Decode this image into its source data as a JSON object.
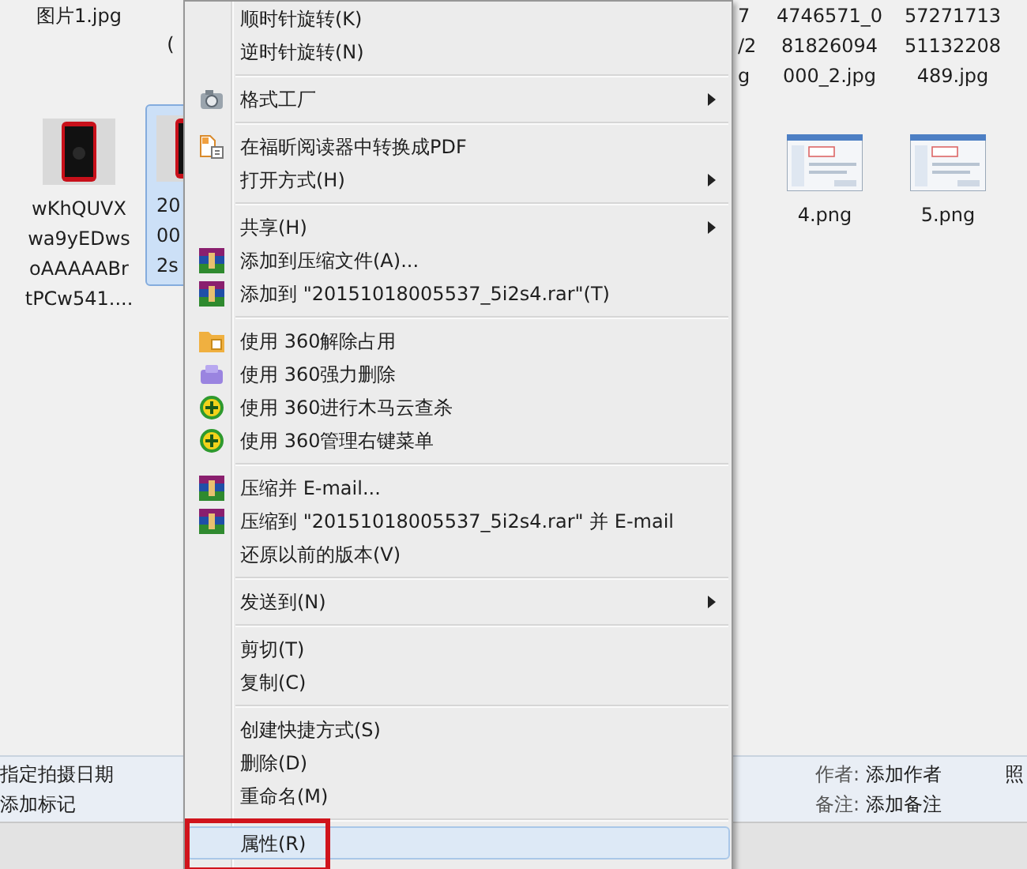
{
  "files": [
    {
      "kind": "label_only",
      "lines": [
        "图片1.jpg"
      ],
      "selected": false
    },
    {
      "kind": "label_only",
      "lines": [
        "("
      ],
      "selected": false
    },
    {
      "kind": "label_only",
      "lines": [
        "7",
        "/2",
        "g"
      ],
      "selected": false
    },
    {
      "kind": "label_only",
      "lines": [
        "4746571_0",
        "81826094",
        "000_2.jpg"
      ],
      "selected": false
    },
    {
      "kind": "label_only",
      "lines": [
        "57271713",
        "51132208",
        "489.jpg"
      ],
      "selected": false
    },
    {
      "lines": [
        "wKhQUVX",
        "wa9yEDws",
        "oAAAAABr",
        "tPCw541...."
      ],
      "selected": false
    },
    {
      "lines": [
        "20",
        "00",
        "2s"
      ],
      "selected": true
    },
    {
      "kind": "screenshot",
      "lines": [
        "4.png"
      ],
      "selected": false
    },
    {
      "kind": "screenshot",
      "lines": [
        "5.png"
      ],
      "selected": false
    }
  ],
  "details": {
    "left": [
      "指定拍摄日期",
      "添加标记"
    ],
    "fields": [
      {
        "name": "作者:",
        "value": "添加作者"
      },
      {
        "name": "备注:",
        "value": "添加备注"
      }
    ],
    "right_cut": "照"
  },
  "menu": [
    {
      "kind": "item",
      "label": "顺时针旋转(K)",
      "submenu": false,
      "selected": false,
      "outlined": false
    },
    {
      "kind": "item",
      "label": "逆时针旋转(N)",
      "submenu": false,
      "selected": false,
      "outlined": false
    },
    {
      "kind": "separator"
    },
    {
      "kind": "item",
      "label": "格式工厂",
      "submenu": true,
      "selected": false,
      "outlined": false
    },
    {
      "kind": "separator"
    },
    {
      "kind": "item",
      "label": "在福昕阅读器中转换成PDF",
      "submenu": false,
      "selected": false,
      "outlined": false
    },
    {
      "kind": "item",
      "label": "打开方式(H)",
      "submenu": true,
      "selected": false,
      "outlined": false
    },
    {
      "kind": "separator"
    },
    {
      "kind": "item",
      "label": "共享(H)",
      "submenu": true,
      "selected": false,
      "outlined": false
    },
    {
      "kind": "item",
      "label": "添加到压缩文件(A)...",
      "submenu": false,
      "selected": false,
      "outlined": false
    },
    {
      "kind": "item",
      "label": "添加到 \"20151018005537_5i2s4.rar\"(T)",
      "submenu": false,
      "selected": false,
      "outlined": false
    },
    {
      "kind": "separator"
    },
    {
      "kind": "item",
      "label": "使用 360解除占用",
      "submenu": false,
      "selected": false,
      "outlined": false
    },
    {
      "kind": "item",
      "label": "使用 360强力删除",
      "submenu": false,
      "selected": false,
      "outlined": false
    },
    {
      "kind": "item",
      "label": "使用 360进行木马云查杀",
      "submenu": false,
      "selected": false,
      "outlined": false
    },
    {
      "kind": "item",
      "label": "使用 360管理右键菜单",
      "submenu": false,
      "selected": false,
      "outlined": false
    },
    {
      "kind": "separator"
    },
    {
      "kind": "item",
      "label": "压缩并 E-mail...",
      "submenu": false,
      "selected": false,
      "outlined": false
    },
    {
      "kind": "item",
      "label": "压缩到 \"20151018005537_5i2s4.rar\" 并 E-mail",
      "submenu": false,
      "selected": false,
      "outlined": false
    },
    {
      "kind": "item",
      "label": "还原以前的版本(V)",
      "submenu": false,
      "selected": false,
      "outlined": false
    },
    {
      "kind": "separator"
    },
    {
      "kind": "item",
      "label": "发送到(N)",
      "submenu": true,
      "selected": false,
      "outlined": false
    },
    {
      "kind": "separator"
    },
    {
      "kind": "item",
      "label": "剪切(T)",
      "submenu": false,
      "selected": false,
      "outlined": false
    },
    {
      "kind": "item",
      "label": "复制(C)",
      "submenu": false,
      "selected": false,
      "outlined": false
    },
    {
      "kind": "separator"
    },
    {
      "kind": "item",
      "label": "创建快捷方式(S)",
      "submenu": false,
      "selected": false,
      "outlined": false
    },
    {
      "kind": "item",
      "label": "删除(D)",
      "submenu": false,
      "selected": false,
      "outlined": false
    },
    {
      "kind": "item",
      "label": "重命名(M)",
      "submenu": false,
      "selected": false,
      "outlined": false
    },
    {
      "kind": "separator"
    },
    {
      "kind": "item",
      "label": "属性(R)",
      "submenu": false,
      "selected": true,
      "outlined": true
    }
  ]
}
